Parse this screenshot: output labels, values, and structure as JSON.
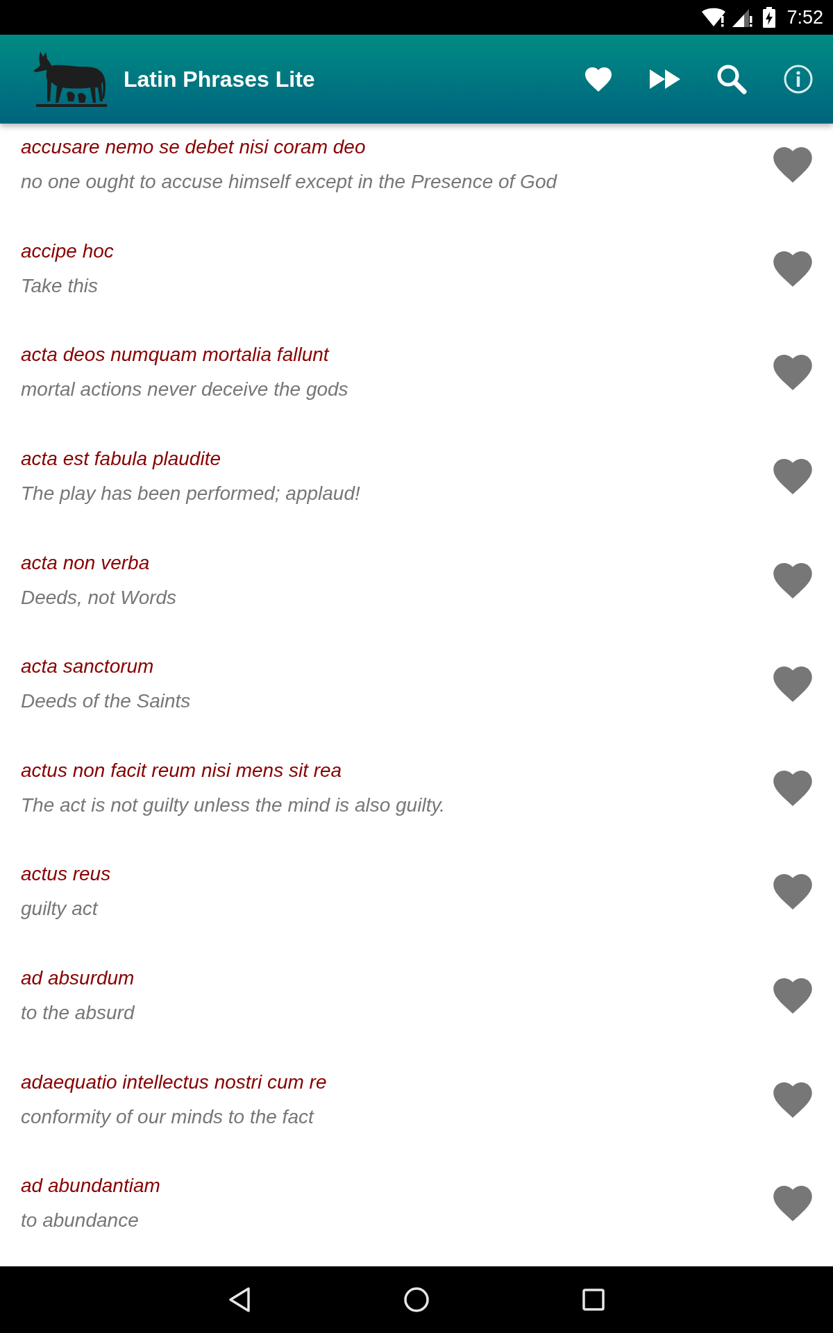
{
  "status_bar": {
    "time": "7:52"
  },
  "app_bar": {
    "title": "Latin Phrases Lite"
  },
  "phrases": [
    {
      "latin": "accusare nemo se debet nisi coram deo",
      "english": "no one ought to accuse himself except in the Presence of God",
      "favorite": false
    },
    {
      "latin": "accipe hoc",
      "english": "Take this",
      "favorite": false
    },
    {
      "latin": "acta deos numquam mortalia fallunt",
      "english": "mortal actions never deceive the gods",
      "favorite": false
    },
    {
      "latin": "acta est fabula plaudite",
      "english": "The play has been performed; applaud!",
      "favorite": false
    },
    {
      "latin": "acta non verba",
      "english": "Deeds, not Words",
      "favorite": false
    },
    {
      "latin": "acta sanctorum",
      "english": "Deeds of the Saints",
      "favorite": false
    },
    {
      "latin": "actus non facit reum nisi mens sit rea",
      "english": "The act is not guilty unless the mind is also guilty.",
      "favorite": false
    },
    {
      "latin": "actus reus",
      "english": "guilty act",
      "favorite": false
    },
    {
      "latin": "ad absurdum",
      "english": "to the absurd",
      "favorite": false
    },
    {
      "latin": "adaequatio intellectus nostri cum re",
      "english": "conformity of our minds to the fact",
      "favorite": false
    },
    {
      "latin": "ad abundantiam",
      "english": "to abundance",
      "favorite": false
    }
  ]
}
